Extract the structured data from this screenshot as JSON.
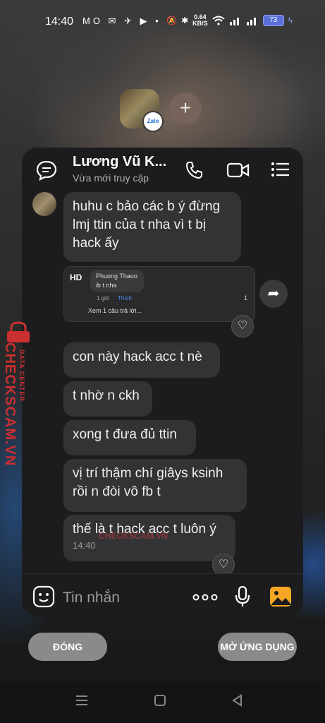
{
  "status_bar": {
    "time": "14:40",
    "left_icons": "MO ✉ ✈ ▶ •",
    "speed_value": "0.64",
    "speed_unit": "KB/S",
    "battery": "73"
  },
  "header": {
    "contact_name": "Lương Vũ K...",
    "contact_status": "Vừa mới truy cập",
    "zalo_badge": "Zalo",
    "add_symbol": "+"
  },
  "messages": [
    {
      "text": "huhu c bảo các b ý đừng lmj ttin của t nha vì t bị hack ấy"
    },
    {
      "text": "con này hack acc t nè"
    },
    {
      "text": "t nhờ n ckh"
    },
    {
      "text": "xong t đưa đủ ttin"
    },
    {
      "text": "vị trí thậm chí giâys ksinh rồi n đòi vô fb t"
    },
    {
      "text": "thế là t hack acc t luôn ý",
      "time": "14:40"
    }
  ],
  "shared_post": {
    "avatar_initials": "HD",
    "commenter": "Phuong Thaoo",
    "comment": "ib t nha",
    "comment_time": "1 giờ",
    "like_label": "Thích",
    "like_count": "1",
    "replies_label": "Xem 1 câu trả lời..."
  },
  "composer": {
    "placeholder": "Tin nhắn",
    "more_symbol": "ooo"
  },
  "watermark": {
    "brand": "CHECKSCAM.VN",
    "sub": "DATA CENTER"
  },
  "buttons": {
    "close": "ĐÓNG",
    "open_app": "MỞ ỨNG DỤNG"
  },
  "icons": {
    "chat": "chat-bubble-icon",
    "call": "phone-icon",
    "video": "video-camera-icon",
    "menu": "menu-icon",
    "sticker": "sticker-icon",
    "mic": "microphone-icon",
    "image": "image-icon",
    "forward": "forward-icon",
    "heart": "heart-icon"
  },
  "colors": {
    "bubble": "#333336",
    "card": "#1c1c1e",
    "accent_like": "#4a8ff0",
    "watermark": "#c93030",
    "image_icon": "#f5a623"
  }
}
